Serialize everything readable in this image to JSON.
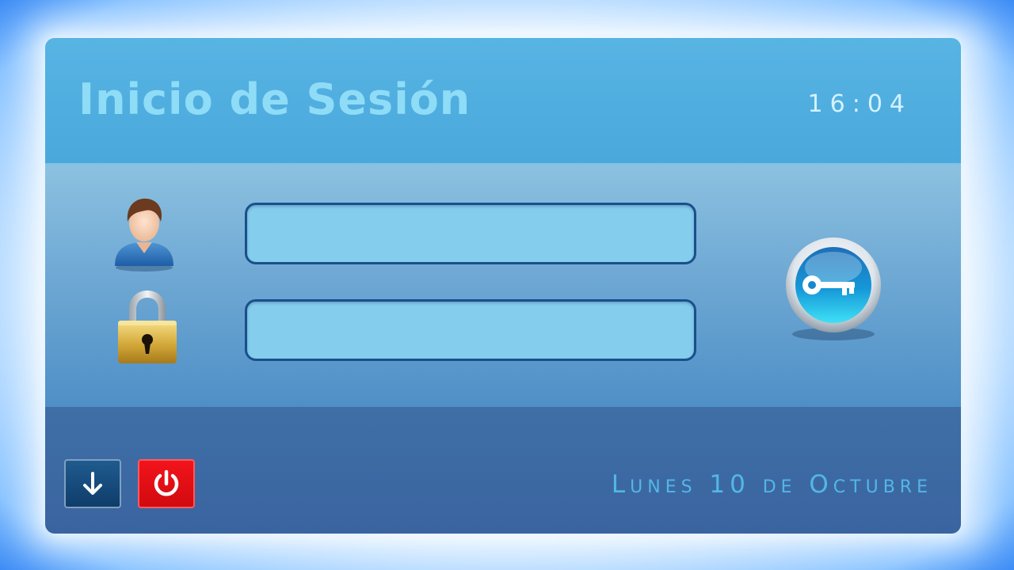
{
  "header": {
    "title": "Inicio de Sesión",
    "time": "16:04"
  },
  "form": {
    "username": {
      "value": "",
      "placeholder": "",
      "icon": "user-icon"
    },
    "password": {
      "value": "",
      "placeholder": "",
      "icon": "lock-icon"
    },
    "login_button_icon": "key-icon"
  },
  "footer": {
    "date": "Lunes 10 de Octubre",
    "buttons": [
      {
        "name": "download-button",
        "icon": "arrow-down-icon"
      },
      {
        "name": "power-button",
        "icon": "power-icon"
      }
    ]
  },
  "colors": {
    "header_bg": "#4aa8dc",
    "title": "#8fdcf7",
    "field_bg": "#85cdec",
    "field_border": "#1a4f8c",
    "footer_bg": "#3a64a0",
    "date_text": "#52b7e6",
    "power_red": "#e10f15"
  }
}
